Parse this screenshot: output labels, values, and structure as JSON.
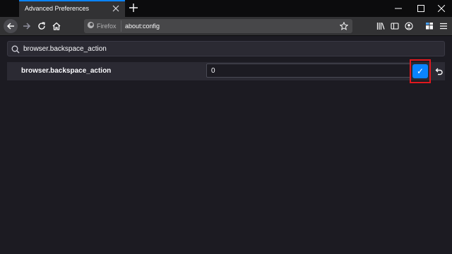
{
  "tab": {
    "title": "Advanced Preferences"
  },
  "urlbar": {
    "identity_label": "Firefox",
    "url": "about:config"
  },
  "search": {
    "value": "browser.backspace_action"
  },
  "pref": {
    "name": "browser.backspace_action",
    "value": "0",
    "save_glyph": "✓"
  },
  "colors": {
    "accent": "#0a84ff",
    "highlight_box": "#e0181e",
    "page_bg": "#1c1b22"
  },
  "icons": [
    "close-icon",
    "plus-icon",
    "minimize-icon",
    "maximize-icon",
    "window-close-icon",
    "back-arrow-icon",
    "forward-arrow-icon",
    "reload-icon",
    "home-icon",
    "firefox-icon",
    "star-icon",
    "library-icon",
    "sidebar-icon",
    "account-icon",
    "extensions-icon",
    "menu-icon",
    "search-icon",
    "checkmark-icon",
    "undo-icon"
  ]
}
